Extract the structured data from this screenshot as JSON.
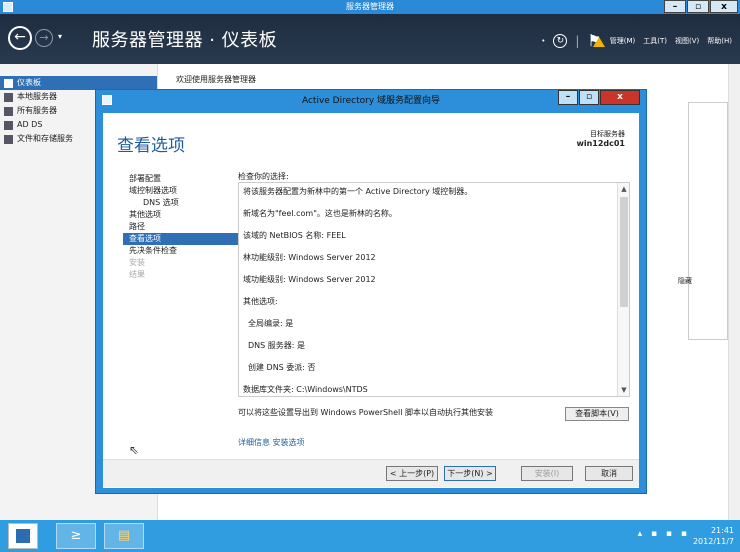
{
  "outer_window": {
    "title": "服务器管理器"
  },
  "header": {
    "back_icon": "back-arrow-icon",
    "title": "服务器管理器 · 仪表板",
    "menu": {
      "manage": "管理(M)",
      "tools": "工具(T)",
      "view": "视图(V)",
      "help": "帮助(H)"
    }
  },
  "sidebar": {
    "items": [
      {
        "label": "仪表板"
      },
      {
        "label": "本地服务器"
      },
      {
        "label": "所有服务器"
      },
      {
        "label": "AD DS"
      },
      {
        "label": "文件和存储服务"
      }
    ]
  },
  "main": {
    "welcome": "欢迎使用服务器管理器",
    "hide": "隐藏"
  },
  "dialog": {
    "title": "Active Directory 域服务配置向导",
    "heading": "查看选项",
    "target_label": "目标服务器",
    "target_name": "win12dc01",
    "steps": [
      {
        "label": "部署配置"
      },
      {
        "label": "域控制器选项"
      },
      {
        "label": "DNS 选项"
      },
      {
        "label": "其他选项"
      },
      {
        "label": "路径"
      },
      {
        "label": "查看选项"
      },
      {
        "label": "先决条件检查"
      },
      {
        "label": "安装"
      },
      {
        "label": "结果"
      }
    ],
    "review_label": "检查你的选择:",
    "review_lines": [
      "将该服务器配置为新林中的第一个 Active Directory 域控制器。",
      "新域名为\"feel.com\"。这也是新林的名称。",
      "该域的 NetBIOS 名称: FEEL",
      "林功能级别: Windows Server 2012",
      "域功能级别: Windows Server 2012",
      "其他选项:",
      "全局编录: 是",
      "DNS 服务器: 是",
      "创建 DNS 委派: 否",
      "数据库文件夹: C:\\Windows\\NTDS"
    ],
    "export_text": "可以将这些设置导出到 Windows PowerShell 脚本以自动执行其他安装",
    "view_script": "查看脚本(V)",
    "more_info": "详细信息 安装选项",
    "buttons": {
      "prev": "< 上一步(P)",
      "next": "下一步(N) >",
      "install": "安装(I)",
      "cancel": "取消"
    }
  },
  "taskbar": {
    "time": "21:41",
    "date": "2012/11/7"
  }
}
